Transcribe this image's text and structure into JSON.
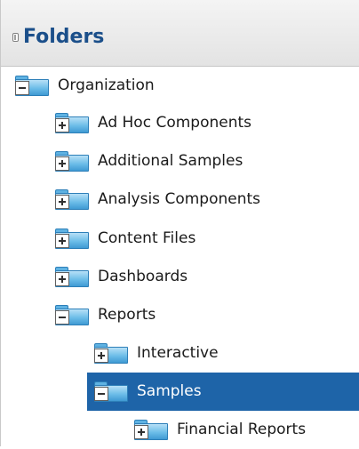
{
  "panel": {
    "title": "Folders"
  },
  "tree": {
    "organization": {
      "label": "Organization",
      "state": "expanded"
    },
    "ad_hoc": {
      "label": "Ad Hoc Components",
      "state": "collapsed"
    },
    "additional_samples": {
      "label": "Additional Samples",
      "state": "collapsed"
    },
    "analysis_components": {
      "label": "Analysis Components",
      "state": "collapsed"
    },
    "content_files": {
      "label": "Content Files",
      "state": "collapsed"
    },
    "dashboards": {
      "label": "Dashboards",
      "state": "collapsed"
    },
    "reports": {
      "label": "Reports",
      "state": "expanded"
    },
    "interactive": {
      "label": "Interactive",
      "state": "collapsed"
    },
    "samples": {
      "label": "Samples",
      "state": "expanded",
      "selected": true
    },
    "financial_reports": {
      "label": "Financial Reports",
      "state": "collapsed"
    }
  },
  "colors": {
    "title": "#1b4f8a",
    "selection": "#1e64a8",
    "folder": "#6cbde8"
  },
  "icons": {
    "expanded": "minus-box-icon",
    "collapsed": "plus-box-icon",
    "folder": "folder-icon"
  }
}
